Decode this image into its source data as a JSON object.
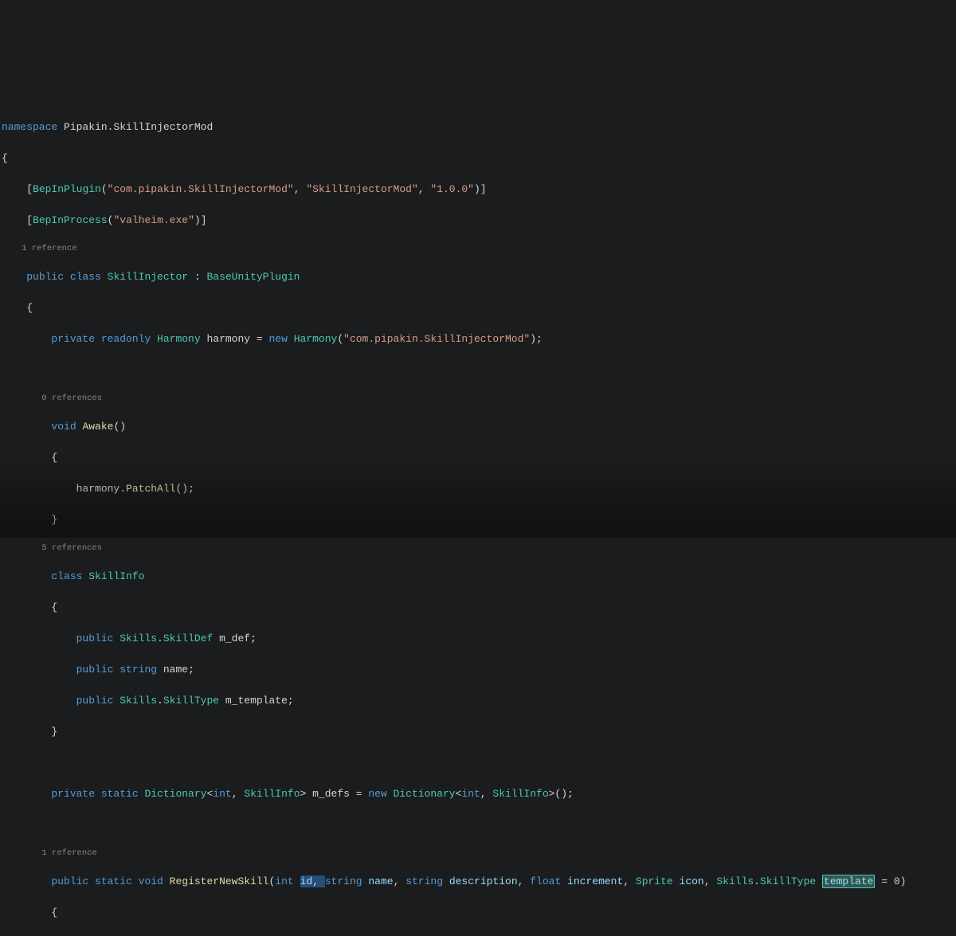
{
  "code": {
    "l1_kw": "namespace",
    "l1_ns": " Pipakin.SkillInjectorMod",
    "l2": "{",
    "l3_ind": "    ",
    "l3_br1": "[",
    "l3_attr": "BepInPlugin",
    "l3_p1": "(",
    "l3_s1": "\"com.pipakin.SkillInjectorMod\"",
    "l3_c1": ", ",
    "l3_s2": "\"SkillInjectorMod\"",
    "l3_c2": ", ",
    "l3_s3": "\"1.0.0\"",
    "l3_p2": ")]",
    "l4_ind": "    ",
    "l4_br1": "[",
    "l4_attr": "BepInProcess",
    "l4_p1": "(",
    "l4_s1": "\"valheim.exe\"",
    "l4_p2": ")]",
    "lens1_ind": "    ",
    "lens1": "1 reference",
    "l5_ind": "    ",
    "l5_kw1": "public",
    "l5_kw2": " class",
    "l5_cls": " SkillInjector",
    "l5_colon": " : ",
    "l5_base": "BaseUnityPlugin",
    "l6_ind": "    ",
    "l6": "{",
    "l7_ind": "        ",
    "l7_kw1": "private",
    "l7_kw2": " readonly",
    "l7_type": " Harmony",
    "l7_var": " harmony",
    "l7_eq": " = ",
    "l7_kw3": "new",
    "l7_ctor": " Harmony",
    "l7_p1": "(",
    "l7_s1": "\"com.pipakin.SkillInjectorMod\"",
    "l7_p2": ");",
    "lens2_ind": "        ",
    "lens2": "0 references",
    "l9_ind": "        ",
    "l9_kw": "void",
    "l9_mtd": " Awake",
    "l9_p": "()",
    "l10_ind": "        ",
    "l10": "{",
    "l11_ind": "            ",
    "l11_var": "harmony",
    "l11_dot": ".",
    "l11_mtd": "PatchAll",
    "l11_p": "();",
    "l12_ind": "        ",
    "l12": "}",
    "lens3_ind": "        ",
    "lens3": "5 references",
    "l13_ind": "        ",
    "l13_kw": "class",
    "l13_cls": " SkillInfo",
    "l14_ind": "        ",
    "l14": "{",
    "l15_ind": "            ",
    "l15_kw": "public",
    "l15_t1": " Skills",
    "l15_dot": ".",
    "l15_t2": "SkillDef",
    "l15_var": " m_def",
    "l15_semi": ";",
    "l16_ind": "            ",
    "l16_kw": "public",
    "l16_type": " string",
    "l16_var": " name",
    "l16_semi": ";",
    "l17_ind": "            ",
    "l17_kw": "public",
    "l17_t1": " Skills",
    "l17_dot": ".",
    "l17_t2": "SkillType",
    "l17_var": " m_template",
    "l17_semi": ";",
    "l18_ind": "        ",
    "l18": "}",
    "l20_ind": "        ",
    "l20_kw1": "private",
    "l20_kw2": " static",
    "l20_t1": " Dictionary",
    "l20_lt": "<",
    "l20_t2": "int",
    "l20_c1": ", ",
    "l20_t3": "SkillInfo",
    "l20_gt": ">",
    "l20_var": " m_defs",
    "l20_eq": " = ",
    "l20_kw3": "new",
    "l20_t4": " Dictionary",
    "l20_lt2": "<",
    "l20_t5": "int",
    "l20_c2": ", ",
    "l20_t6": "SkillInfo",
    "l20_gt2": ">();",
    "lens4_ind": "        ",
    "lens4": "1 reference",
    "l22_ind": "        ",
    "l22_kw1": "public",
    "l22_kw2": " static",
    "l22_kw3": " void",
    "l22_mtd": " RegisterNewSkill",
    "l22_p1": "(",
    "l22_t1": "int",
    "l22_sp1": " ",
    "l22_v1": "id",
    "l22_c1": ", ",
    "l22_t2": "string",
    "l22_sp2": " ",
    "l22_v2": "name",
    "l22_c2": ", ",
    "l22_t3": "string",
    "l22_sp3": " ",
    "l22_v3": "description",
    "l22_c3": ", ",
    "l22_t4": "float",
    "l22_sp4": " ",
    "l22_v4": "increment",
    "l22_c4": ", ",
    "l22_t5": "Sprite",
    "l22_sp5": " ",
    "l22_v5": "icon",
    "l22_c5": ", ",
    "l22_t6": "Skills",
    "l22_dot": ".",
    "l22_t7": "SkillType",
    "l22_sp6": " ",
    "l22_v6": "template",
    "l22_eq": " = 0)",
    "l23_ind": "        ",
    "l23": "{"
  }
}
